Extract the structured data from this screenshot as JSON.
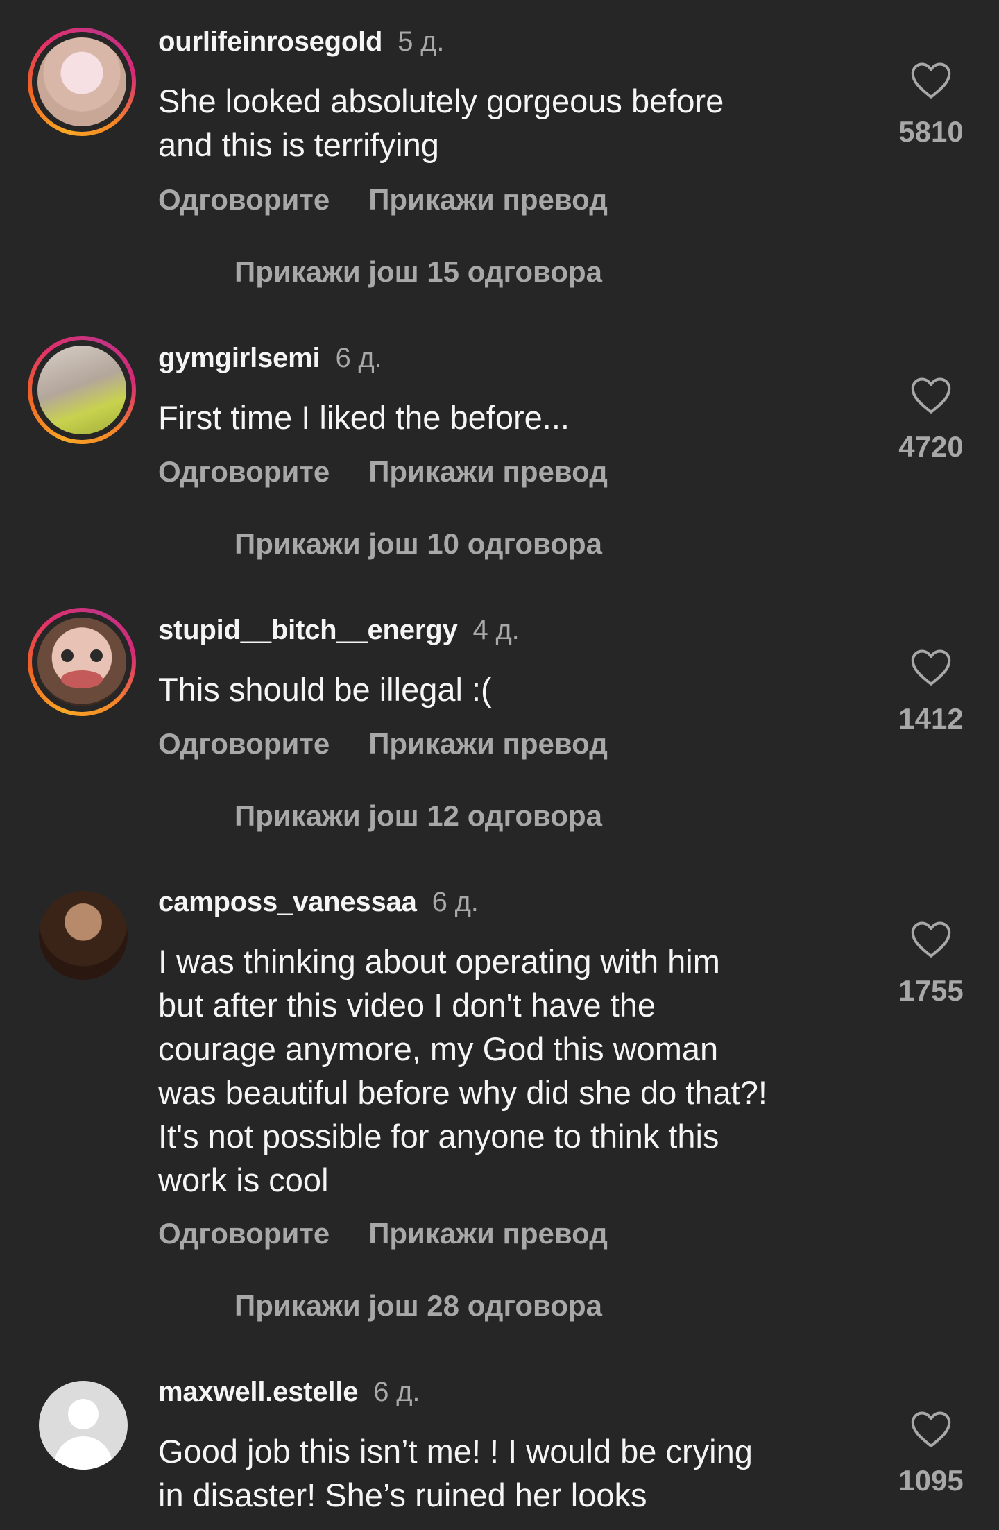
{
  "comments": [
    {
      "username": "ourlifeinrosegold",
      "time": "5 д.",
      "text": "She looked absolutely gorgeous before\nand this is terrifying",
      "reply": "Одговорите",
      "translate": "Прикажи превод",
      "more_replies": "Прикажи још 15 одговора",
      "likes": "5810"
    },
    {
      "username": "gymgirlsemi",
      "time": "6 д.",
      "text": "First time I liked the before...",
      "reply": "Одговорите",
      "translate": "Прикажи превод",
      "more_replies": "Прикажи још 10 одговора",
      "likes": "4720"
    },
    {
      "username": "stupid__bitch__energy",
      "time": "4 д.",
      "text": "This should be illegal :(",
      "reply": "Одговорите",
      "translate": "Прикажи превод",
      "more_replies": "Прикажи још 12 одговора",
      "likes": "1412"
    },
    {
      "username": "camposs_vanessaa",
      "time": "6 д.",
      "text": "I was thinking about operating with him\nbut after this video I don't have the\ncourage anymore, my God this woman\nwas beautiful before why did she do that?!\nIt's not possible for anyone to think this\nwork is cool",
      "reply": "Одговорите",
      "translate": "Прикажи превод",
      "more_replies": "Прикажи још 28 одговора",
      "likes": "1755"
    },
    {
      "username": "maxwell.estelle",
      "time": "6 д.",
      "text": "Good job this isn’t me! ! I would be crying\nin disaster! She’s ruined her looks",
      "likes": "1095"
    }
  ],
  "colors": {
    "background": "#262626",
    "primary_text": "#f5f5f5",
    "secondary_text": "#a8a8a8"
  },
  "icons": {
    "like": "heart-outline-icon"
  }
}
